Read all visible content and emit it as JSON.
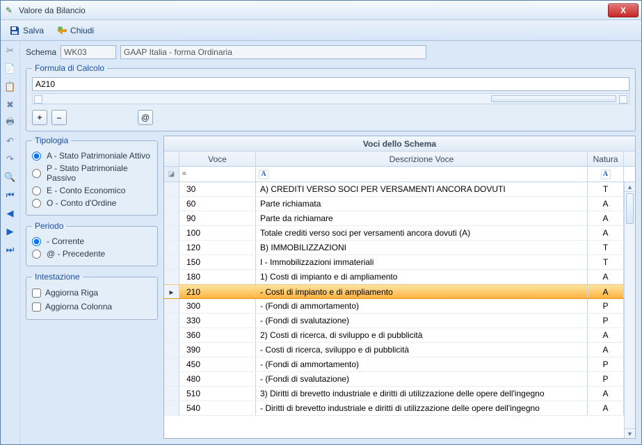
{
  "window": {
    "title": "Valore da Bilancio"
  },
  "toolbar": {
    "save_label": "Salva",
    "close_label": "Chiudi"
  },
  "schema": {
    "label": "Schema",
    "code": "WK03",
    "desc": "GAAP Italia - forma Ordinaria"
  },
  "formula": {
    "legend": "Formula di Calcolo",
    "value": "A210",
    "buttons": {
      "plus": "+",
      "minus": "–",
      "at": "@"
    }
  },
  "tipologia": {
    "legend": "Tipologia",
    "options": [
      {
        "label": "A - Stato Patrimoniale Attivo",
        "checked": true
      },
      {
        "label": "P - Stato Patrimoniale Passivo",
        "checked": false
      },
      {
        "label": "E - Conto Economico",
        "checked": false
      },
      {
        "label": "O - Conto d'Ordine",
        "checked": false
      }
    ]
  },
  "periodo": {
    "legend": "Periodo",
    "options": [
      {
        "label": "   - Corrente",
        "checked": true
      },
      {
        "label": "@ - Precedente",
        "checked": false
      }
    ]
  },
  "intestazione": {
    "legend": "Intestazione",
    "options": [
      {
        "label": "Aggiorna Riga"
      },
      {
        "label": "Aggiorna Colonna"
      }
    ]
  },
  "grid": {
    "title": "Voci dello Schema",
    "columns": {
      "voce": "Voce",
      "desc": "Descrizione Voce",
      "natura": "Natura"
    },
    "rows": [
      {
        "voce": "30",
        "desc": "A) CREDITI VERSO SOCI PER VERSAMENTI ANCORA DOVUTI",
        "nat": "T"
      },
      {
        "voce": "60",
        "desc": "Parte richiamata",
        "nat": "A"
      },
      {
        "voce": "90",
        "desc": "Parte da richiamare",
        "nat": "A"
      },
      {
        "voce": "100",
        "desc": "Totale crediti verso soci per versamenti ancora dovuti (A)",
        "nat": "A"
      },
      {
        "voce": "120",
        "desc": "B) IMMOBILIZZAZIONI",
        "nat": "T"
      },
      {
        "voce": "150",
        "desc": "I - Immobilizzazioni immateriali",
        "nat": "T"
      },
      {
        "voce": "180",
        "desc": "1) Costi di impianto e di ampliamento",
        "nat": "A"
      },
      {
        "voce": "210",
        "desc": "- Costi di impianto e di ampliamento",
        "nat": "A",
        "selected": true
      },
      {
        "voce": "300",
        "desc": "- (Fondi di ammortamento)",
        "nat": "P"
      },
      {
        "voce": "330",
        "desc": "- (Fondi di svalutazione)",
        "nat": "P"
      },
      {
        "voce": "360",
        "desc": "2) Costi di ricerca, di sviluppo e di pubblicità",
        "nat": "A"
      },
      {
        "voce": "390",
        "desc": "- Costi di ricerca, sviluppo e di pubblicità",
        "nat": "A"
      },
      {
        "voce": "450",
        "desc": "- (Fondi di ammortamento)",
        "nat": "P"
      },
      {
        "voce": "480",
        "desc": "- (Fondi di svalutazione)",
        "nat": "P"
      },
      {
        "voce": "510",
        "desc": "3) Diritti di brevetto industriale e diritti di utilizzazione delle opere dell'ingegno",
        "nat": "A"
      },
      {
        "voce": "540",
        "desc": "- Diritti di brevetto industriale e diritti di utilizzazione delle opere dell'ingegno",
        "nat": "A"
      }
    ]
  }
}
